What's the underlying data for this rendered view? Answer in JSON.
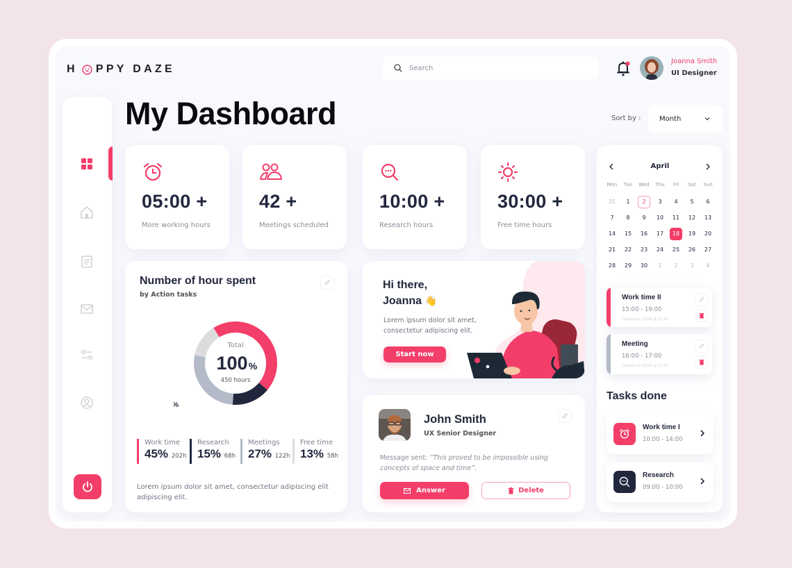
{
  "brand": {
    "logo_prefix": "H",
    "logo_suffix": "PPY DAZE",
    "accent_color": "#f33e6a",
    "dark_color": "#22273d"
  },
  "header": {
    "search_placeholder": "Search",
    "notifications_unread": true,
    "user": {
      "name": "Joanna Smith",
      "role": "UI Designer"
    }
  },
  "page": {
    "title": "My Dashboard",
    "sort_label": "Sort by :",
    "sort_value": "Month"
  },
  "sidebar": {
    "items": [
      {
        "id": "dashboard",
        "icon": "grid-icon",
        "active": true
      },
      {
        "id": "home",
        "icon": "home-icon",
        "active": false
      },
      {
        "id": "documents",
        "icon": "document-icon",
        "active": false
      },
      {
        "id": "messages",
        "icon": "mail-icon",
        "active": false
      },
      {
        "id": "settings",
        "icon": "sliders-icon",
        "active": false
      },
      {
        "id": "profile",
        "icon": "user-circle-icon",
        "active": false
      }
    ],
    "logout_icon": "power-icon"
  },
  "stats": [
    {
      "icon": "alarm-clock-icon",
      "value": "05:00 +",
      "label": "More working hours"
    },
    {
      "icon": "users-icon",
      "value": "42 +",
      "label": "Meetings scheduled"
    },
    {
      "icon": "search-chat-icon",
      "value": "10:00 +",
      "label": "Research hours"
    },
    {
      "icon": "sun-icon",
      "value": "30:00 +",
      "label": "Free time hours"
    }
  ],
  "hours_card": {
    "title": "Number of hour spent",
    "subtitle": "by Action tasks",
    "center_label": "Total",
    "center_value": "100",
    "center_unit": "%",
    "center_sub": "450 hours",
    "legend": [
      {
        "name": "Work time",
        "percent": "45%",
        "hours": "202h",
        "color": "#f33e6a"
      },
      {
        "name": "Research",
        "percent": "15%",
        "hours": "68h",
        "color": "#22273d"
      },
      {
        "name": "Meetings",
        "percent": "27%",
        "hours": "122h",
        "color": "#b4bac8"
      },
      {
        "name": "Free time",
        "percent": "13%",
        "hours": "58h",
        "color": "#dcdcdf"
      }
    ],
    "description": "Lorem ipsum dolor sit amet, consectetur adipiscing elit adipiscing elit."
  },
  "chart_data": {
    "type": "pie",
    "title": "Number of hour spent",
    "subtitle": "by Action tasks",
    "categories": [
      "Work time",
      "Research",
      "Meetings",
      "Free time"
    ],
    "values": [
      45,
      15,
      27,
      13
    ],
    "hours": [
      202,
      68,
      122,
      58
    ],
    "labels": [
      "45%",
      "15%",
      "27%",
      "13%"
    ],
    "colors": [
      "#f33e6a",
      "#22273d",
      "#b4bac8",
      "#dcdcdf"
    ],
    "total_label": "Total",
    "total_value": "100%",
    "total_hours": "450 hours",
    "donut": true
  },
  "welcome": {
    "greeting_line1": "Hi there,",
    "greeting_line2": "Joanna",
    "emoji": "👋",
    "text": "Lorem ipsum dolor sit amet, consectetur adipiscing elit.",
    "button": "Start now"
  },
  "message_card": {
    "name": "John Smith",
    "role": "UX Senior Designer",
    "message_prefix": "Message sent: ",
    "message": "“This proved to be impossible using concepts of space and time”.",
    "answer_label": "Answer",
    "delete_label": "Delete"
  },
  "calendar": {
    "month": "April",
    "weekdays": [
      "Mon",
      "Tue",
      "Wed",
      "Thu",
      "Fri",
      "Sat",
      "Sun"
    ],
    "weeks": [
      [
        {
          "d": "31",
          "m": true
        },
        {
          "d": "1"
        },
        {
          "d": "2",
          "outlined": true
        },
        {
          "d": "3"
        },
        {
          "d": "4"
        },
        {
          "d": "5"
        },
        {
          "d": "6"
        }
      ],
      [
        {
          "d": "7"
        },
        {
          "d": "8"
        },
        {
          "d": "9"
        },
        {
          "d": "10"
        },
        {
          "d": "11"
        },
        {
          "d": "12"
        },
        {
          "d": "13"
        }
      ],
      [
        {
          "d": "14"
        },
        {
          "d": "15"
        },
        {
          "d": "16"
        },
        {
          "d": "17"
        },
        {
          "d": "18",
          "selected": true
        },
        {
          "d": "19"
        },
        {
          "d": "20"
        }
      ],
      [
        {
          "d": "21"
        },
        {
          "d": "22"
        },
        {
          "d": "23"
        },
        {
          "d": "24"
        },
        {
          "d": "25"
        },
        {
          "d": "26"
        },
        {
          "d": "27"
        }
      ],
      [
        {
          "d": "28"
        },
        {
          "d": "29"
        },
        {
          "d": "30"
        },
        {
          "d": "1",
          "m": true
        },
        {
          "d": "2",
          "m": true
        },
        {
          "d": "3",
          "m": true
        },
        {
          "d": "4",
          "m": true
        }
      ]
    ]
  },
  "events": [
    {
      "title": "Work time II",
      "time": "15:00 - 19:00",
      "created": "Created on 01/04 @ 13:12",
      "color": "#f33e6a"
    },
    {
      "title": "Meeting",
      "time": "16:00 - 17:00",
      "created": "Created on 01/04 @ 13:12",
      "color": "#b4bac8"
    }
  ],
  "tasks_done": {
    "title": "Tasks done",
    "items": [
      {
        "title": "Work time I",
        "time": "10:00 - 14:00",
        "icon": "alarm-clock-icon",
        "color": "#f33e6a"
      },
      {
        "title": "Research",
        "time": "09:00 - 10:00",
        "icon": "search-chat-icon",
        "color": "#22273d"
      }
    ]
  }
}
